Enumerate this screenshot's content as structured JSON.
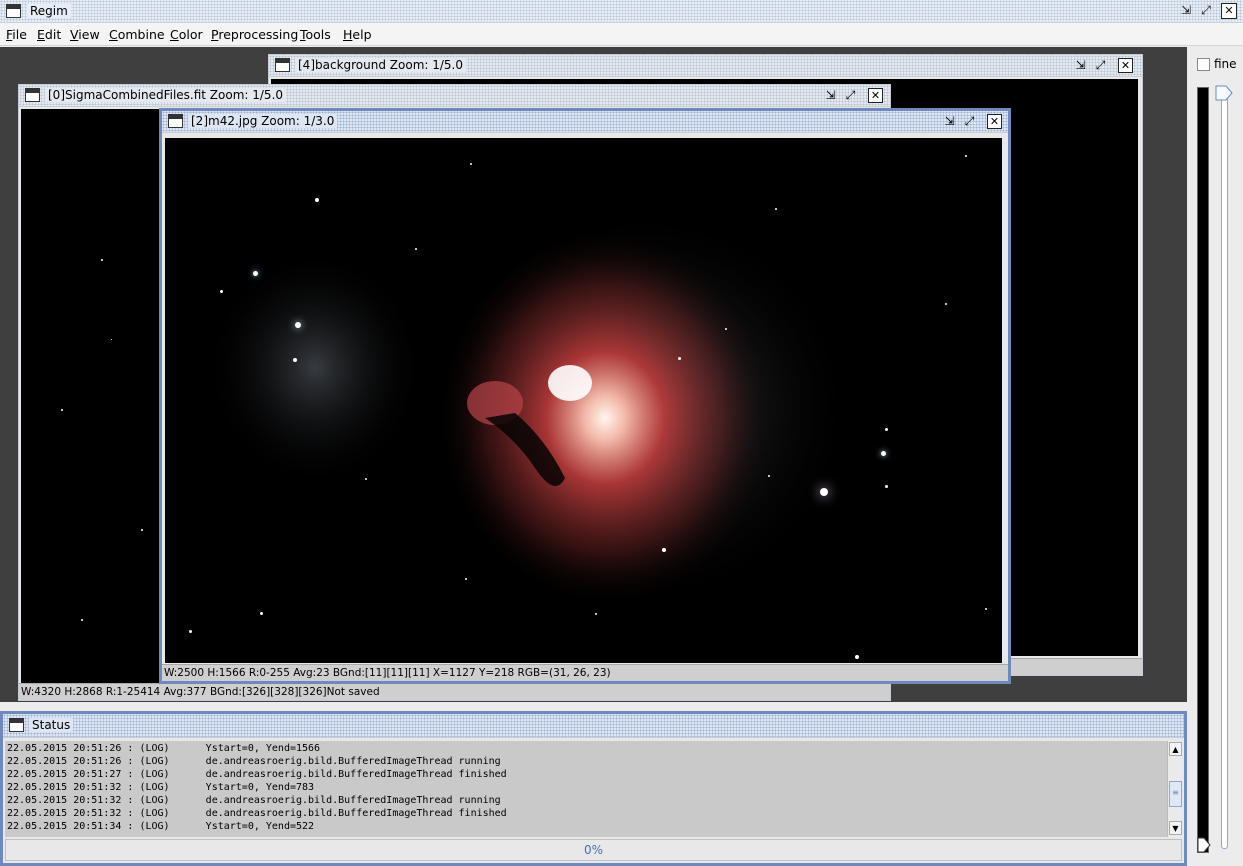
{
  "app": {
    "title": "Regim",
    "controls": {
      "iconify": "⇲",
      "maximize": "⤢",
      "close": "✕"
    }
  },
  "menu": {
    "items": [
      {
        "label": "File"
      },
      {
        "label": "Edit"
      },
      {
        "label": "View"
      },
      {
        "label": "Combine"
      },
      {
        "label": "Color"
      },
      {
        "label": "Preprocessing"
      },
      {
        "label": "Tools"
      },
      {
        "label": "Help"
      }
    ]
  },
  "frames": {
    "background": {
      "title": "[4]background  Zoom: 1/5.0",
      "info": ""
    },
    "sigma": {
      "title": "[0]SigmaCombinedFiles.fit  Zoom: 1/5.0",
      "info": "W:4320 H:2868 R:1-25414 Avg:377 BGnd:[326][328][326]Not saved"
    },
    "m42": {
      "title": "[2]m42.jpg  Zoom: 1/3.0",
      "info": "W:2500 H:1566 R:0-255 Avg:23 BGnd:[11][11][11] X=1127 Y=218 RGB=(31, 26, 23)"
    }
  },
  "right_panel": {
    "fine_label": "fine",
    "fine_checked": false
  },
  "status": {
    "title": "Status",
    "log": [
      "22.05.2015 20:51:26 : (LOG)      Ystart=0, Yend=1566",
      "22.05.2015 20:51:26 : (LOG)      de.andreasroerig.bild.BufferedImageThread running",
      "22.05.2015 20:51:27 : (LOG)      de.andreasroerig.bild.BufferedImageThread finished",
      "22.05.2015 20:51:32 : (LOG)      Ystart=0, Yend=783",
      "22.05.2015 20:51:32 : (LOG)      de.andreasroerig.bild.BufferedImageThread running",
      "22.05.2015 20:51:32 : (LOG)      de.andreasroerig.bild.BufferedImageThread finished",
      "22.05.2015 20:51:34 : (LOG)      Ystart=0, Yend=522"
    ],
    "progress_text": "0%",
    "progress_value": 0
  },
  "colors": {
    "active_frame_border": "#6f89bf",
    "desktop_bg": "#3f3f3f",
    "nebula_red": "#c23a3a"
  }
}
